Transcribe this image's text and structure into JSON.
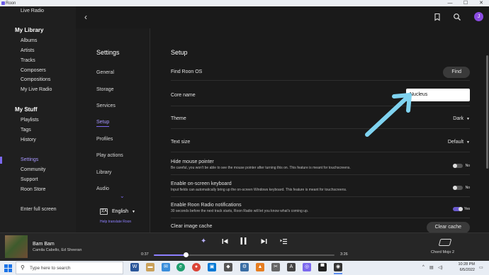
{
  "window": {
    "title": "Roon",
    "minimize": "—",
    "maximize": "☐",
    "close": "✕"
  },
  "sidebar": {
    "top_item": "Live Radio",
    "library_heading": "My Library",
    "library_items": [
      "Albums",
      "Artists",
      "Tracks",
      "Composers",
      "Compositions",
      "My Live Radio"
    ],
    "stuff_heading": "My Stuff",
    "stuff_items": [
      "Playlists",
      "Tags",
      "History"
    ],
    "bottom_items": [
      "Settings",
      "Community",
      "Support",
      "Roon Store"
    ],
    "fullscreen": "Enter full screen"
  },
  "topbar": {
    "back": "‹",
    "avatar_initial": "J"
  },
  "settings_nav": {
    "title": "Settings",
    "items": [
      "General",
      "Storage",
      "Services",
      "Setup",
      "Profiles",
      "Play actions",
      "Library",
      "Audio"
    ],
    "active": "Setup",
    "language": "English",
    "help_link": "Help translate Roon"
  },
  "main": {
    "title": "Setup",
    "find_roon_os": {
      "label": "Find Roon OS",
      "button": "Find"
    },
    "core_name": {
      "label": "Core name",
      "value": "Nucleus"
    },
    "theme": {
      "label": "Theme",
      "value": "Dark"
    },
    "text_size": {
      "label": "Text size",
      "value": "Default"
    },
    "hide_mouse": {
      "label": "Hide mouse pointer",
      "desc": "Be careful, you won't be able to see the mouse pointer after turning this on. This feature is meant for touchscreens.",
      "state": "No"
    },
    "onscreen_kb": {
      "label": "Enable on-screen keyboard",
      "desc": "Input fields can automatically bring up the on-screen Windows keyboard. This feature is meant for touchscreens.",
      "state": "No"
    },
    "radio_notif": {
      "label": "Enable Roon Radio notifications",
      "desc": "30 seconds before the next track starts, Roon Radio will let you know what's coming up.",
      "state": "Yes"
    },
    "clear_cache": {
      "label": "Clear image cache",
      "button": "Clear cache"
    }
  },
  "player": {
    "track": "Bam Bam",
    "artist": "Camila Cabello, Ed Sheeran",
    "elapsed": "0:37",
    "duration": "3:26",
    "progress_fraction": 0.18,
    "zone": "Chord Mojo 2"
  },
  "taskbar": {
    "search_placeholder": "Type here to search",
    "time": "10:28 PM",
    "date": "6/5/2022"
  },
  "colors": {
    "accent": "#7b68ee",
    "background": "#1a1a1a",
    "annotation_arrow": "#7fd3f0"
  }
}
